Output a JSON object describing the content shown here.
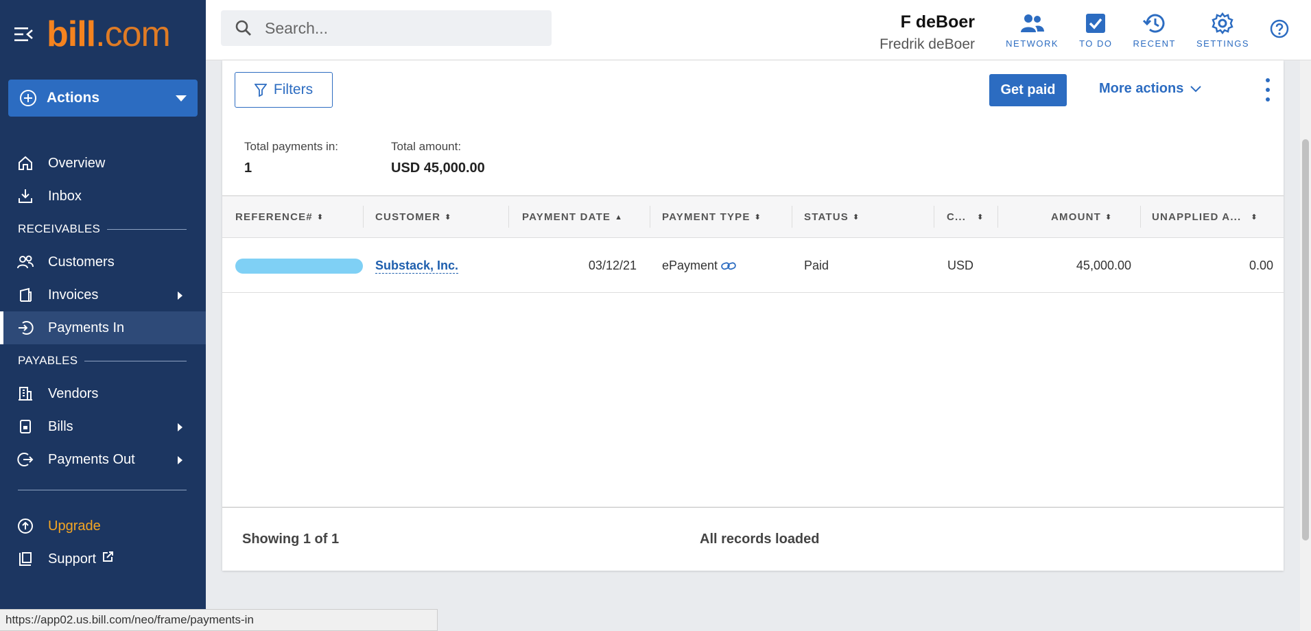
{
  "sidebar": {
    "logo_main": "bill",
    "logo_dot": ".",
    "logo_suffix": "com",
    "actions_label": "Actions",
    "items": {
      "overview": "Overview",
      "inbox": "Inbox",
      "receivables_section": "RECEIVABLES",
      "customers": "Customers",
      "invoices": "Invoices",
      "payments_in": "Payments In",
      "payables_section": "PAYABLES",
      "vendors": "Vendors",
      "bills": "Bills",
      "payments_out": "Payments Out",
      "upgrade": "Upgrade",
      "support": "Support"
    },
    "colors": {
      "background": "#1c3661",
      "accent": "#f5831f",
      "upgrade": "#f5a623"
    }
  },
  "topbar": {
    "search_placeholder": "Search...",
    "user_name": "F deBoer",
    "org_name": "Fredrik deBoer",
    "icons": {
      "network": "NETWORK",
      "todo": "TO DO",
      "recent": "RECENT",
      "settings": "SETTINGS"
    }
  },
  "toolbar": {
    "filters_label": "Filters",
    "get_paid_label": "Get paid",
    "more_actions_label": "More actions"
  },
  "summary": {
    "total_payments_label": "Total payments in:",
    "total_payments_value": "1",
    "total_amount_label": "Total amount:",
    "total_amount_value": "USD 45,000.00"
  },
  "table": {
    "columns": {
      "reference": "REFERENCE#",
      "customer": "CUSTOMER",
      "payment_date": "PAYMENT DATE",
      "payment_type": "PAYMENT TYPE",
      "status": "STATUS",
      "currency": "C...",
      "amount": "AMOUNT",
      "unapplied": "UNAPPLIED A..."
    },
    "rows": [
      {
        "customer": "Substack, Inc.",
        "payment_date": "03/12/21",
        "payment_type": "ePayment",
        "status": "Paid",
        "currency": "USD",
        "amount": "45,000.00",
        "unapplied": "0.00"
      }
    ],
    "showing": "Showing 1 of 1",
    "loaded": "All records loaded"
  },
  "statusbar": {
    "url": "https://app02.us.bill.com/neo/frame/payments-in"
  }
}
